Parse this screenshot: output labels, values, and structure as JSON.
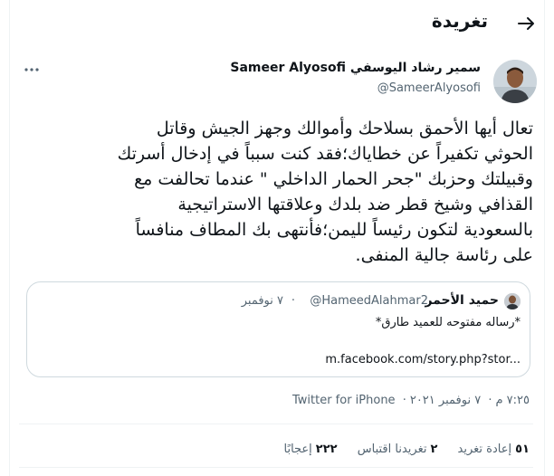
{
  "header": {
    "title": "تغريدة"
  },
  "tweet": {
    "author_name": "سمير رشاد اليوسفي Sameer Alyosofi",
    "author_handle": "@SameerAlyosofi",
    "text": "تعال أيها الأحمق بسلاحك وأموالك وجهز الجيش وقاتل\nالحوثي تكفيراً  عن خطاياك؛فقد كنت سبباً في إدخال أسرتك\nوقبيلتك وحزبك \"جحر الحمار الداخلي \" عندما تحالفت مع\nالقذافي وشيخ قطر ضد بلدك وعلاقتها الاستراتيجية\nبالسعودية لتكون رئيساً لليمن؛فأنتهى بك المطاف منافساً\nعلى رئاسة جالية المنفى.",
    "quote": {
      "name": "حميد الأحمر",
      "handle": "@HameedAlahmar2",
      "separator": "·",
      "date": "٧ نوفمبر",
      "text": "*رساله مفتوحه للعميد طارق*",
      "link": "m.facebook.com/story.php?stor..."
    },
    "time": "٧:٢٥ م",
    "date": "٧ نوفمبر ٢٠٢١",
    "source": "Twitter for iPhone",
    "separator": "·"
  },
  "stats": {
    "retweets_count": "٥١",
    "retweets_label": "إعادة تغريد",
    "quotes_count": "٢",
    "quotes_label": "تغريدنا اقتباس",
    "likes_count": "٢٢٢",
    "likes_label": "إعجابًا"
  },
  "colors": {
    "text": "#0f1419",
    "secondary": "#536471",
    "border": "#cfd9de"
  },
  "icons": [
    "back-arrow-icon",
    "more-icon"
  ]
}
